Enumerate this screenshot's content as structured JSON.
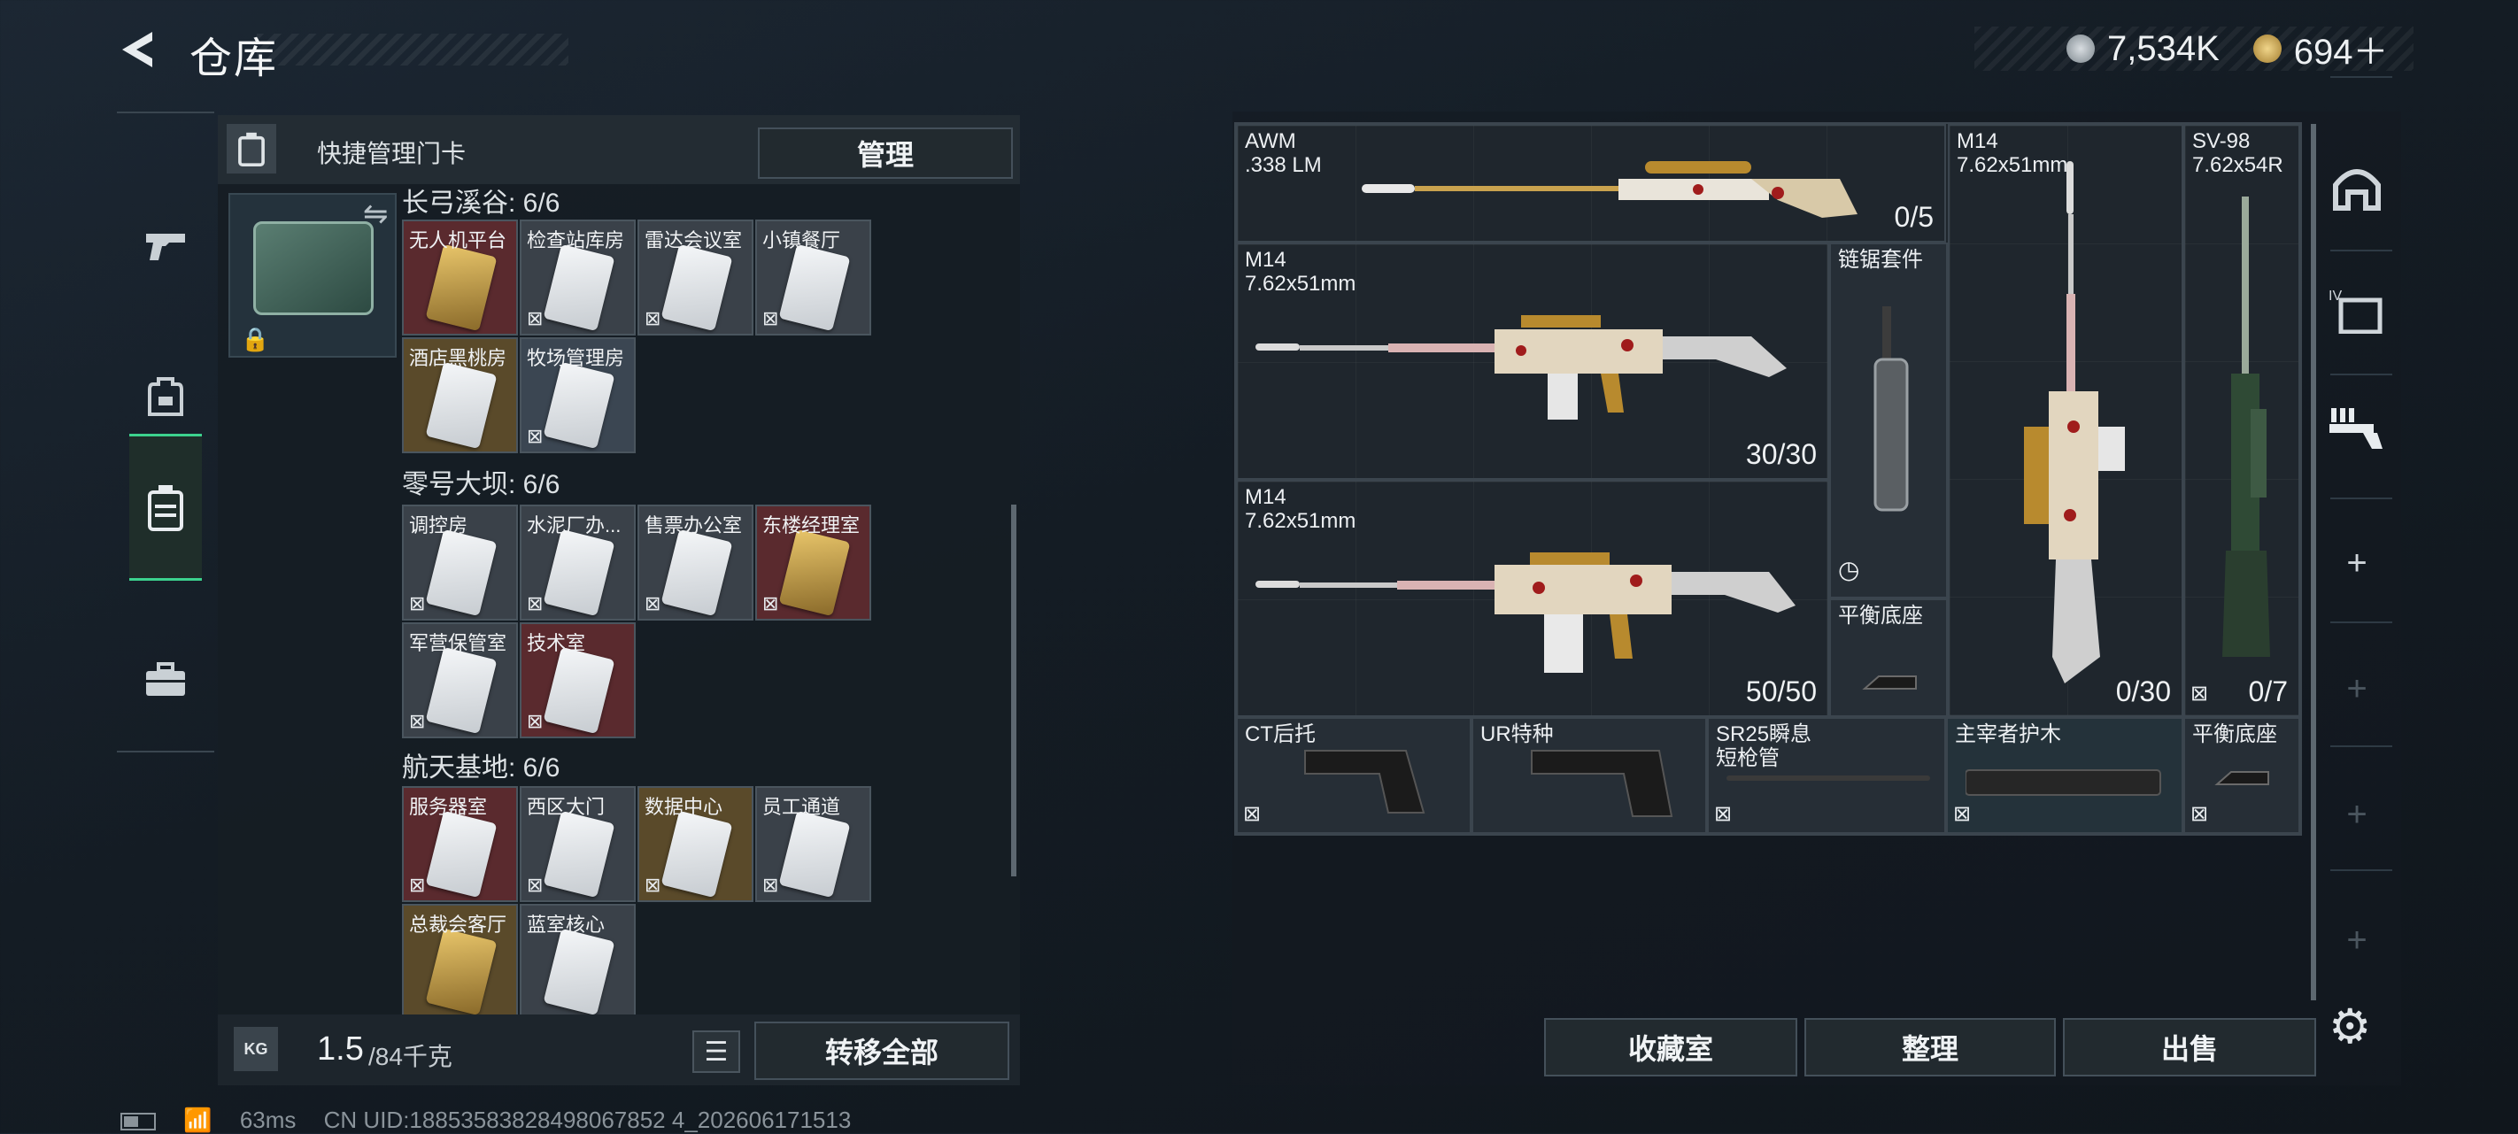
{
  "header": {
    "title": "仓库",
    "back_icon": "back-arrow-icon"
  },
  "currency": {
    "primary_value": "7,534K",
    "primary_icon": "silver-coin-icon",
    "secondary_value": "694＋",
    "secondary_icon": "gold-coin-icon",
    "colors": {
      "silver": "#9aa3aa",
      "gold": "#c9a455"
    }
  },
  "left_nav": {
    "items": [
      {
        "icon": "pistol-icon",
        "active": false
      },
      {
        "icon": "backpack-icon",
        "active": false
      },
      {
        "icon": "keycard-case-icon",
        "active": true
      },
      {
        "icon": "toolbox-icon",
        "active": false
      }
    ],
    "active_color": "#3cd28e"
  },
  "key_panel": {
    "header_label": "快捷管理门卡",
    "manage_label": "管理",
    "sections": [
      {
        "title": "长弓溪谷: 6/6",
        "cards": [
          {
            "label": "无人机平台",
            "bg": "red",
            "locked": false
          },
          {
            "label": "检查站库房",
            "bg": "grey",
            "locked": true
          },
          {
            "label": "雷达会议室",
            "bg": "grey",
            "locked": true
          },
          {
            "label": "小镇餐厅",
            "bg": "grey",
            "locked": true
          },
          {
            "label": "酒店黑桃房",
            "bg": "gold",
            "locked": false
          },
          {
            "label": "牧场管理房",
            "bg": "slate",
            "locked": true
          }
        ]
      },
      {
        "title": "零号大坝: 6/6",
        "cards": [
          {
            "label": "调控房",
            "bg": "grey",
            "locked": true
          },
          {
            "label": "水泥厂办...",
            "bg": "grey",
            "locked": true
          },
          {
            "label": "售票办公室",
            "bg": "grey",
            "locked": true
          },
          {
            "label": "东楼经理室",
            "bg": "red",
            "locked": true
          },
          {
            "label": "军营保管室",
            "bg": "grey",
            "locked": true
          },
          {
            "label": "技术室",
            "bg": "red",
            "locked": true
          }
        ]
      },
      {
        "title": "航天基地: 6/6",
        "cards": [
          {
            "label": "服务器室",
            "bg": "red",
            "locked": true
          },
          {
            "label": "西区大门",
            "bg": "grey",
            "locked": true
          },
          {
            "label": "数据中心",
            "bg": "gold",
            "locked": true
          },
          {
            "label": "员工通道",
            "bg": "grey",
            "locked": true
          },
          {
            "label": "总裁会客厅",
            "bg": "gold",
            "locked": false
          },
          {
            "label": "蓝室核心",
            "bg": "grey",
            "locked": false
          }
        ]
      }
    ]
  },
  "weight": {
    "current": "1.5",
    "max": "/84千克",
    "icon_text": "KG",
    "transfer_label": "转移全部"
  },
  "weapons": {
    "awm": {
      "name": "AWM\n.338 LM",
      "count": "0/5"
    },
    "m14_a": {
      "name": "M14\n7.62x51mm",
      "count": "30/30"
    },
    "m14_b": {
      "name": "M14\n7.62x51mm",
      "count": "50/50"
    },
    "m14_c": {
      "name": "M14\n7.62x51mm",
      "count": "0/30"
    },
    "sv98": {
      "name": "SV-98\n7.62x54R",
      "count": "0/7"
    },
    "chainsaw_kit": {
      "name": "链锯套件"
    },
    "balance_mount_a": {
      "name": "平衡底座"
    },
    "attachments": [
      {
        "name": "CT后托"
      },
      {
        "name": "UR特种"
      },
      {
        "name": "SR25瞬息\n短枪管"
      },
      {
        "name": "主宰者护木"
      },
      {
        "name": "平衡底座"
      }
    ]
  },
  "bottom_buttons": {
    "collection": "收藏室",
    "organize": "整理",
    "sell": "出售"
  },
  "status": {
    "ping": "63ms",
    "uid": "CN UID:18853583828498067852 4_202606171513"
  }
}
